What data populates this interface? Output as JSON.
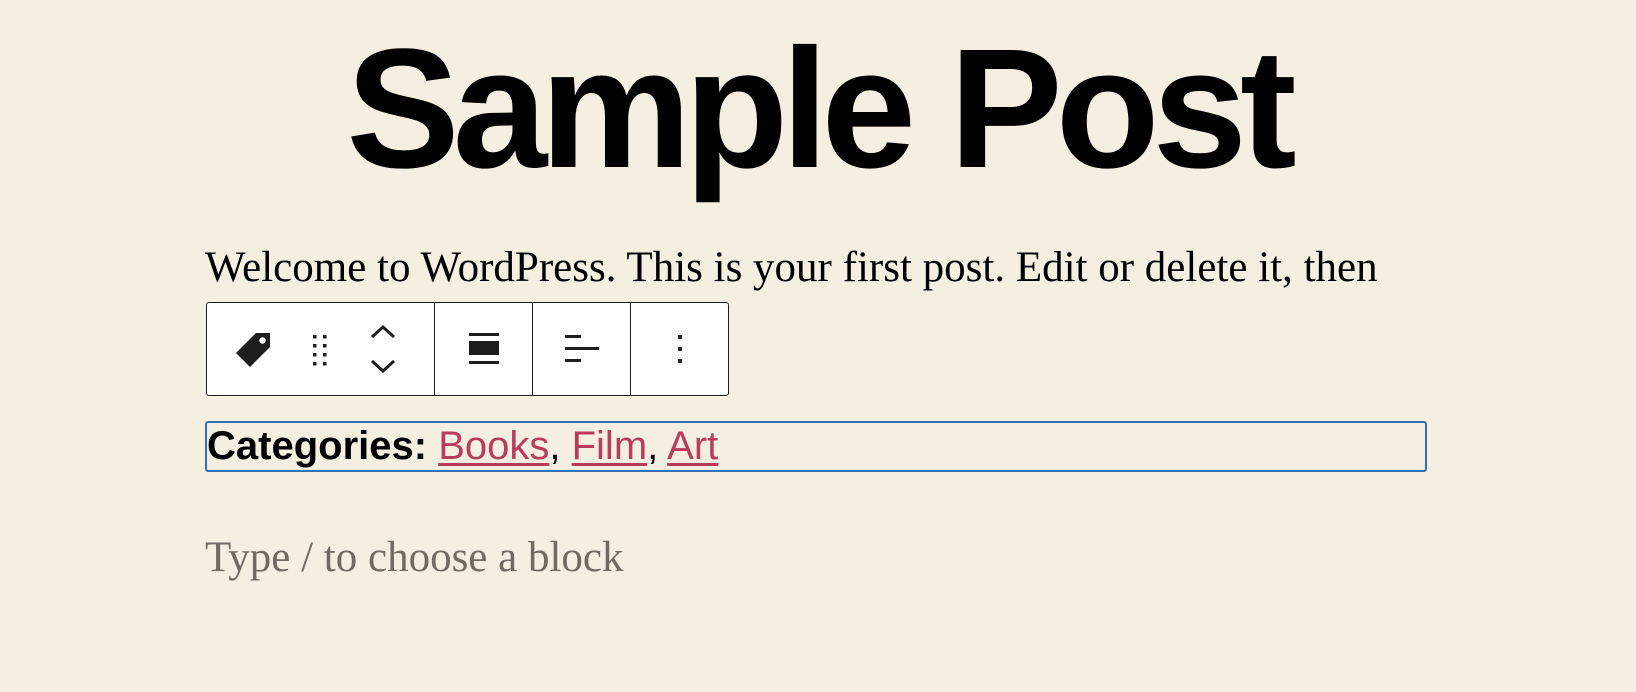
{
  "post": {
    "title": "Sample Post",
    "paragraph": "Welcome to WordPress. This is your first post. Edit or delete it, then"
  },
  "toolbar": {
    "buttons": {
      "block_type": "tag-icon",
      "drag": "drag-handle-icon",
      "move": "move-up-down-icon",
      "width": "full-width-align-icon",
      "text_align": "align-left-icon",
      "options": "more-options-icon"
    }
  },
  "categories": {
    "prefix": "Categories:",
    "items": [
      "Books",
      "Film",
      "Art"
    ],
    "separator": ",",
    "link_color": "#b93d5a",
    "selection_color": "#3171b4"
  },
  "placeholder": "Type / to choose a block",
  "colors": {
    "background": "#f4efe1",
    "placeholder_text": "#6f6b62"
  }
}
